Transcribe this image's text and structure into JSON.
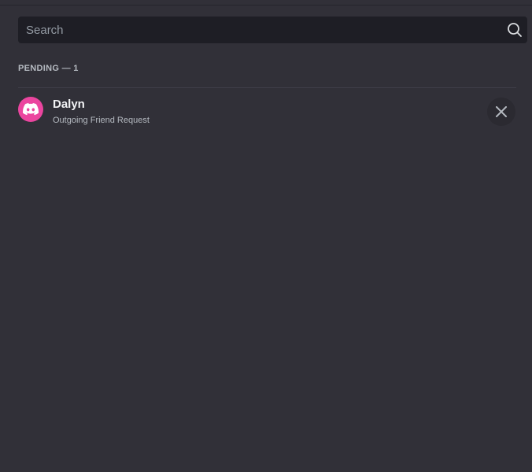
{
  "search": {
    "placeholder": "Search",
    "value": ""
  },
  "pending": {
    "header": "PENDING — 1",
    "items": [
      {
        "name": "Dalyn",
        "status": "Outgoing Friend Request",
        "avatar_color": "#eb459f",
        "icon": "discord-logo-icon",
        "action_icon": "close-icon"
      }
    ]
  }
}
